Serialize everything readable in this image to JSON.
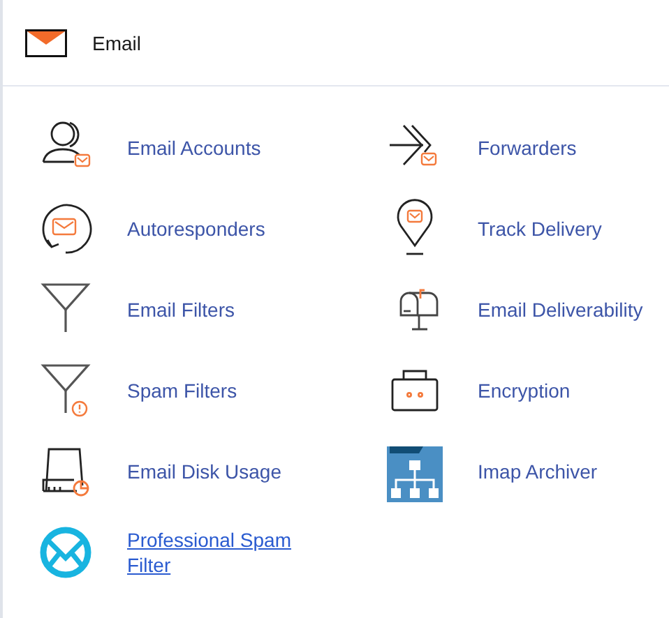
{
  "header": {
    "title": "Email"
  },
  "items": [
    {
      "label": "Email Accounts",
      "kind": "tool"
    },
    {
      "label": "Forwarders",
      "kind": "tool"
    },
    {
      "label": "Autoresponders",
      "kind": "tool"
    },
    {
      "label": "Track Delivery",
      "kind": "tool"
    },
    {
      "label": "Email Filters",
      "kind": "tool"
    },
    {
      "label": "Email Deliverability",
      "kind": "tool"
    },
    {
      "label": "Spam Filters",
      "kind": "tool"
    },
    {
      "label": "Encryption",
      "kind": "tool"
    },
    {
      "label": "Email Disk Usage",
      "kind": "tool"
    },
    {
      "label": "Imap Archiver",
      "kind": "tool"
    },
    {
      "label": "Professional Spam Filter",
      "kind": "link"
    }
  ]
}
